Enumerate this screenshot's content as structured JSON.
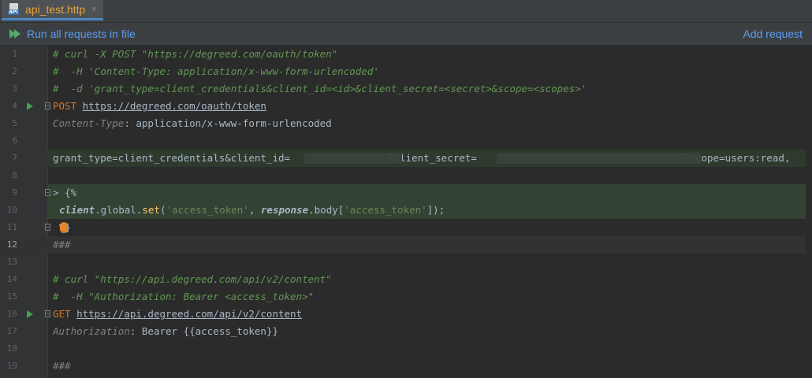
{
  "tab": {
    "title": "api_test.http",
    "close": "×",
    "icon": "api-file-icon"
  },
  "toolbar": {
    "run_all": "Run all requests in file",
    "add_request": "Add request"
  },
  "lines": [
    {
      "n": "1",
      "text": "# curl -X POST \"https://degreed.com/oauth/token\""
    },
    {
      "n": "2",
      "text": "#  -H 'Content-Type: application/x-www-form-urlencoded'"
    },
    {
      "n": "3",
      "text": "#  -d 'grant_type=client_credentials&client_id=<id>&client_secret=<secret>&scope=<scopes>'"
    },
    {
      "n": "4",
      "method": "POST",
      "url": "https://degreed.com/oauth/token"
    },
    {
      "n": "5",
      "header_name": "Content-Type",
      "header_value": ": application/x-www-form-urlencoded"
    },
    {
      "n": "6"
    },
    {
      "n": "7",
      "p1": "grant_type=client_credentials&client_id=",
      "p2": "&client_secret=",
      "p3": "&scope=users:read,"
    },
    {
      "n": "8"
    },
    {
      "n": "9",
      "text": "> {%"
    },
    {
      "n": "10",
      "kw1": "client",
      "mid1": ".global.",
      "fn": "set",
      "open": "(",
      "s1": "'access_token'",
      "comma": ", ",
      "kw2": "response",
      "mid2": ".body[",
      "s2": "'access_token'",
      "close": "]);"
    },
    {
      "n": "11",
      "text": "%}"
    },
    {
      "n": "12",
      "text": "###"
    },
    {
      "n": "13"
    },
    {
      "n": "14",
      "text": "# curl \"https://api.degreed.com/api/v2/content\""
    },
    {
      "n": "15",
      "text": "#  -H \"Authorization: Bearer <access_token>\""
    },
    {
      "n": "16",
      "method": "GET",
      "url": "https://api.degreed.com/api/v2/content"
    },
    {
      "n": "17",
      "header_name": "Authorization",
      "header_value": ": Bearer {{access_token}}"
    },
    {
      "n": "18"
    },
    {
      "n": "19",
      "text": "###"
    }
  ]
}
